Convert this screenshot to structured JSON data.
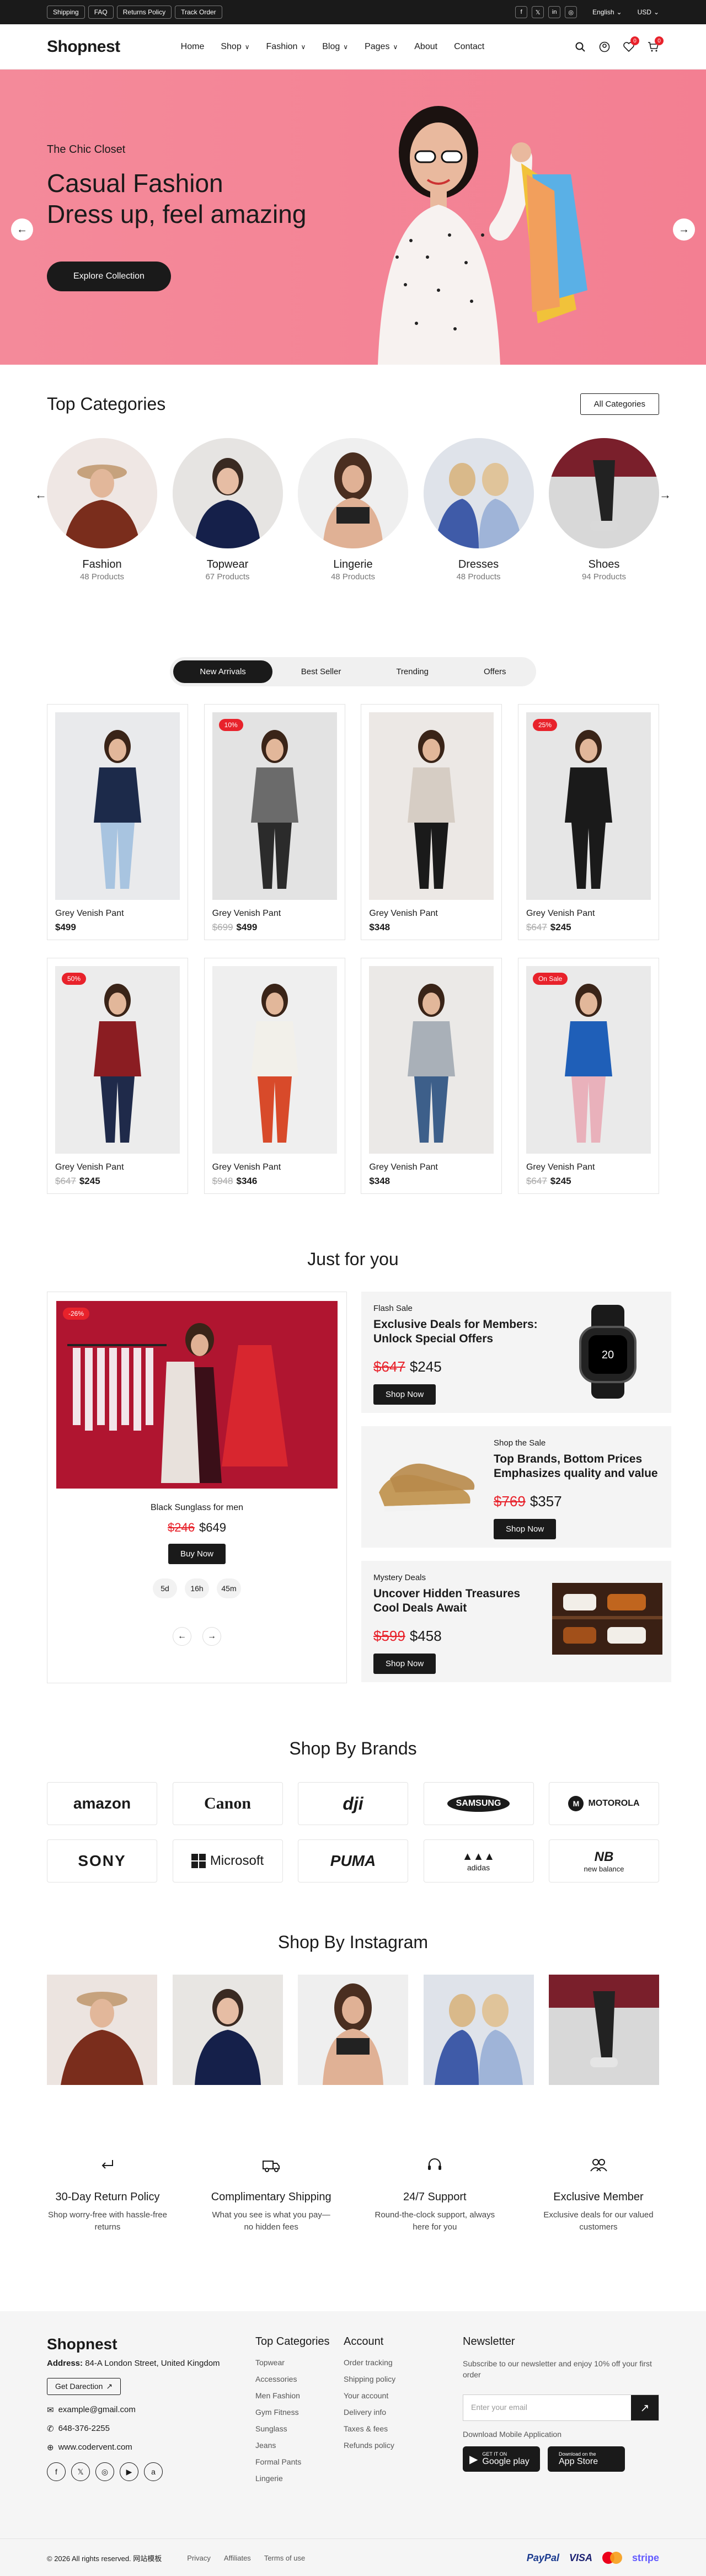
{
  "topbar": {
    "links": [
      "Shipping",
      "FAQ",
      "Returns Policy",
      "Track Order"
    ],
    "language": "English",
    "currency": "USD"
  },
  "header": {
    "logo": "Shopnest",
    "nav": [
      {
        "label": "Home",
        "dropdown": false
      },
      {
        "label": "Shop",
        "dropdown": true
      },
      {
        "label": "Fashion",
        "dropdown": true
      },
      {
        "label": "Blog",
        "dropdown": true
      },
      {
        "label": "Pages",
        "dropdown": true
      },
      {
        "label": "About",
        "dropdown": false
      },
      {
        "label": "Contact",
        "dropdown": false
      }
    ],
    "wishlist_count": "0",
    "cart_count": "0"
  },
  "hero": {
    "subtitle": "The Chic Closet",
    "title_line1": "Casual Fashion",
    "title_line2": "Dress up, feel amazing",
    "button": "Explore Collection"
  },
  "categories": {
    "title": "Top Categories",
    "button": "All Categories",
    "items": [
      {
        "name": "Fashion",
        "count": "48 Products"
      },
      {
        "name": "Topwear",
        "count": "67 Products"
      },
      {
        "name": "Lingerie",
        "count": "48 Products"
      },
      {
        "name": "Dresses",
        "count": "48 Products"
      },
      {
        "name": "Shoes",
        "count": "94 Products"
      }
    ]
  },
  "products": {
    "tabs": [
      "New Arrivals",
      "Best Seller",
      "Trending",
      "Offers"
    ],
    "items": [
      {
        "name": "Grey Venish Pant",
        "old": "",
        "price": "$499",
        "tag": ""
      },
      {
        "name": "Grey Venish Pant",
        "old": "$699",
        "price": "$499",
        "tag": "10%"
      },
      {
        "name": "Grey Venish Pant",
        "old": "",
        "price": "$348",
        "tag": ""
      },
      {
        "name": "Grey Venish Pant",
        "old": "$647",
        "price": "$245",
        "tag": "25%"
      },
      {
        "name": "Grey Venish Pant",
        "old": "$647",
        "price": "$245",
        "tag": "50%"
      },
      {
        "name": "Grey Venish Pant",
        "old": "$948",
        "price": "$346",
        "tag": ""
      },
      {
        "name": "Grey Venish Pant",
        "old": "",
        "price": "$348",
        "tag": ""
      },
      {
        "name": "Grey Venish Pant",
        "old": "$647",
        "price": "$245",
        "tag": "On Sale"
      }
    ]
  },
  "jfy": {
    "title": "Just for you",
    "main": {
      "tag": "-26%",
      "name": "Black Sunglass for men",
      "old": "$246",
      "price": "$649",
      "button": "Buy Now",
      "timer": [
        "5d",
        "16h",
        "45m"
      ]
    },
    "deals": [
      {
        "kicker": "Flash Sale",
        "title": "Exclusive Deals for Members: Unlock Special Offers",
        "old": "$647",
        "price": "$245",
        "button": "Shop Now"
      },
      {
        "kicker": "Shop the Sale",
        "title": "Top Brands, Bottom Prices Emphasizes quality and value",
        "old": "$769",
        "price": "$357",
        "button": "Shop Now"
      },
      {
        "kicker": "Mystery Deals",
        "title": "Uncover Hidden Treasures Cool Deals Await",
        "old": "$599",
        "price": "$458",
        "button": "Shop Now"
      }
    ],
    "watch_time": "20"
  },
  "brands": {
    "title": "Shop By Brands",
    "items": [
      "amazon",
      "Canon",
      "dji",
      "SAMSUNG",
      "MOTOROLA",
      "SONY",
      "Microsoft",
      "PUMA",
      "adidas",
      "new balance"
    ]
  },
  "instagram": {
    "title": "Shop By Instagram"
  },
  "features": [
    {
      "icon": "return-icon",
      "title": "30-Day Return Policy",
      "desc": "Shop worry-free with hassle-free returns"
    },
    {
      "icon": "truck-icon",
      "title": "Complimentary Shipping",
      "desc": "What you see is what you pay—no hidden fees"
    },
    {
      "icon": "headset-icon",
      "title": "24/7 Support",
      "desc": "Round-the-clock support, always here for you"
    },
    {
      "icon": "members-icon",
      "title": "Exclusive Member",
      "desc": "Exclusive deals for our valued customers"
    }
  ],
  "footer": {
    "logo": "Shopnest",
    "address_label": "Address:",
    "address": "84-A London Street, United Kingdom",
    "direction": "Get Darection",
    "email": "example@gmail.com",
    "phone": "648-376-2255",
    "web": "www.codervent.com",
    "col1_title": "Top Categories",
    "col1": [
      "Topwear",
      "Accessories",
      "Men Fashion",
      "Gym Fitness",
      "Sunglass",
      "Jeans",
      "Formal Pants",
      "Lingerie"
    ],
    "col2_title": "Account",
    "col2": [
      "Order tracking",
      "Shipping policy",
      "Your account",
      "Delivery info",
      "Taxes & fees",
      "Refunds policy"
    ],
    "newsletter_title": "Newsletter",
    "newsletter_text": "Subscribe to our newsletter and enjoy 10% off your first order",
    "email_placeholder": "Enter your email",
    "download": "Download Mobile Application",
    "gp_small": "GET IT ON",
    "gp": "Google play",
    "as_small": "Download on the",
    "as": "App Store",
    "copyright": "© 2026 All rights reserved. 网站模板",
    "bottom_links": [
      "Privacy",
      "Affiliates",
      "Terms of use"
    ],
    "payments": [
      "PayPal",
      "VISA",
      "stripe"
    ]
  }
}
